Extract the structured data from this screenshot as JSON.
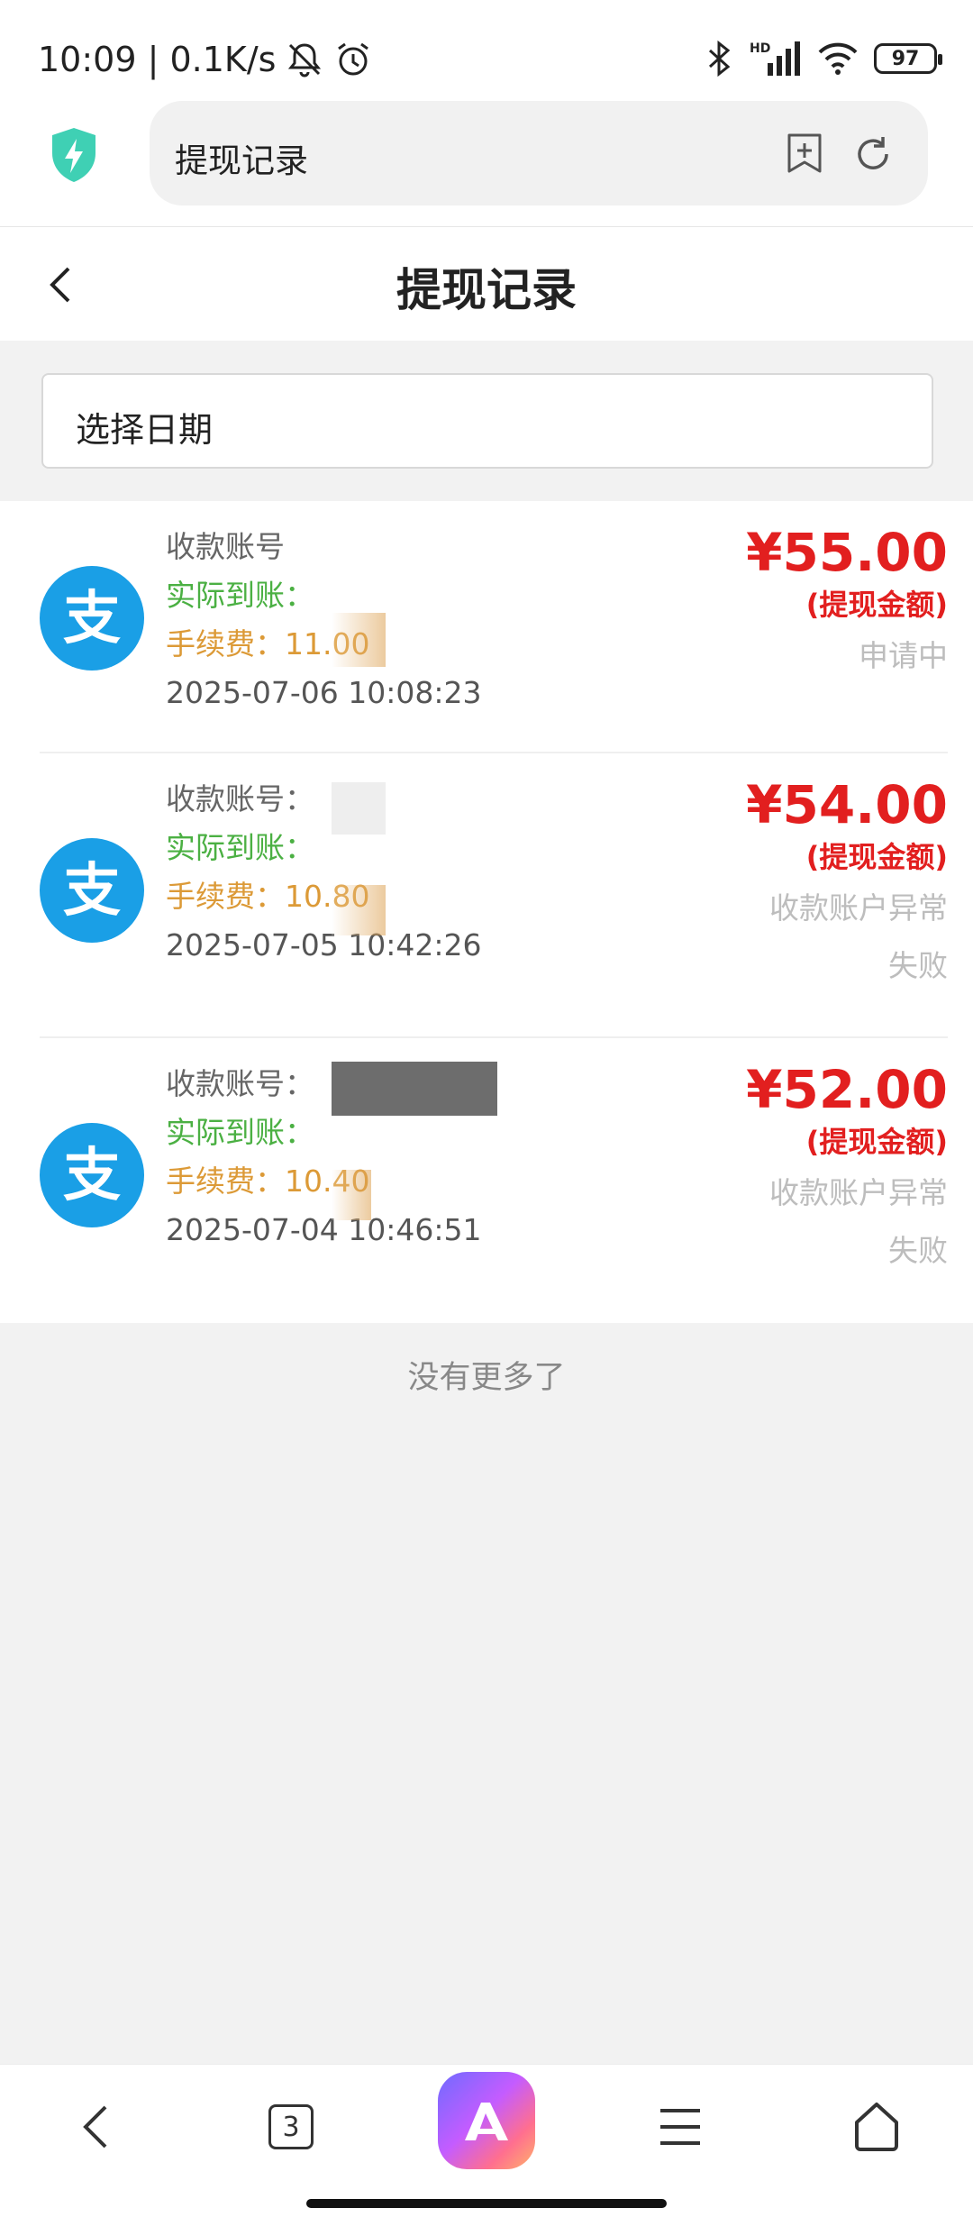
{
  "status_bar": {
    "time_speed": "10:09 | 0.1K/s",
    "battery": "97",
    "signal_label": "HD"
  },
  "browser": {
    "url_title": "提现记录",
    "icons": [
      "shield-bolt-icon",
      "add-bookmark-icon",
      "reload-icon"
    ]
  },
  "header": {
    "title": "提现记录"
  },
  "date_filter": {
    "placeholder": "选择日期"
  },
  "records": [
    {
      "account_label": "收款账号",
      "actual_label": "实际到账：",
      "fee_text": "手续费：11.00",
      "time": "2025-07-06 10:08:23",
      "amount": "¥55.00",
      "amount_label": "(提现金额)",
      "status": "申请中",
      "status2": ""
    },
    {
      "account_label": "收款账号：",
      "actual_label": "实际到账：",
      "fee_text": "手续费：10.80",
      "time": "2025-07-05 10:42:26",
      "amount": "¥54.00",
      "amount_label": "(提现金额)",
      "status": "收款账户异常",
      "status2": "失败"
    },
    {
      "account_label": "收款账号：",
      "actual_label": "实际到账：",
      "fee_text": "手续费：10.40",
      "time": "2025-07-04 10:46:51",
      "amount": "¥52.00",
      "amount_label": "(提现金额)",
      "status": "收款账户异常",
      "status2": "失败"
    }
  ],
  "footer_text": "没有更多了",
  "bottom_nav": {
    "tab_count": "3",
    "colors": {
      "accent": "#e21f1f",
      "alipay": "#1a9fe6",
      "actual": "#4bb043",
      "fee": "#dc9a37"
    }
  }
}
